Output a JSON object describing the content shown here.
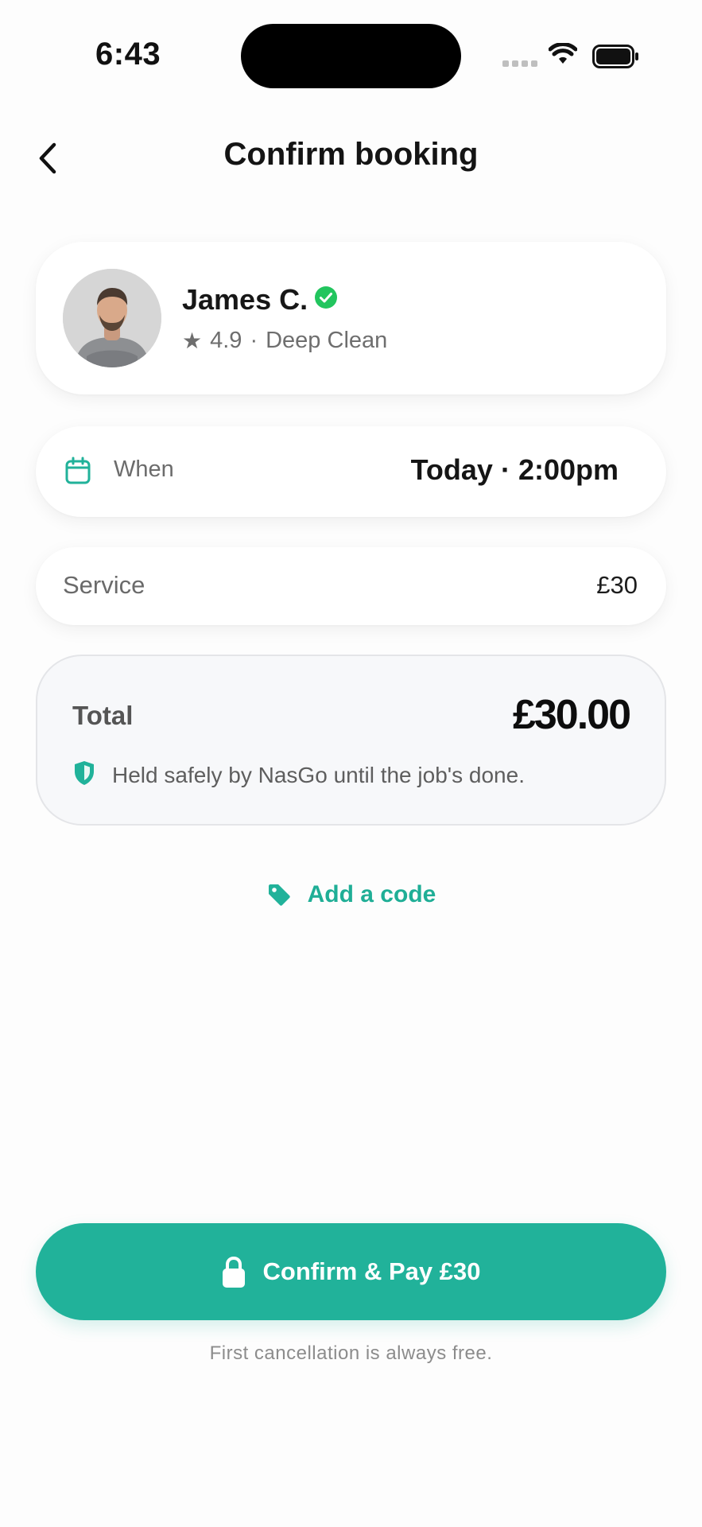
{
  "status_bar": {
    "time": "6:43"
  },
  "header": {
    "title": "Confirm booking"
  },
  "provider": {
    "name": "James C.",
    "rating": "4.9",
    "separator": "·",
    "service_type": "Deep Clean"
  },
  "when": {
    "label": "When",
    "value": "Today · 2:00pm"
  },
  "service": {
    "label": "Service",
    "price": "£30"
  },
  "total": {
    "label": "Total",
    "amount": "£30.00",
    "note": "Held safely by NasGo until the job's done."
  },
  "promo": {
    "label": "Add a code"
  },
  "pay_button": {
    "label": "Confirm & Pay £30"
  },
  "footnote": "First cancellation is always free.",
  "colors": {
    "accent": "#21b29a",
    "verified": "#22c55e",
    "text": "#161616",
    "muted": "#6e6e6e"
  },
  "icons": [
    "back-chevron-icon",
    "wifi-icon",
    "battery-icon",
    "verified-check-icon",
    "star-icon",
    "calendar-icon",
    "shield-icon",
    "tag-icon",
    "lock-icon"
  ]
}
